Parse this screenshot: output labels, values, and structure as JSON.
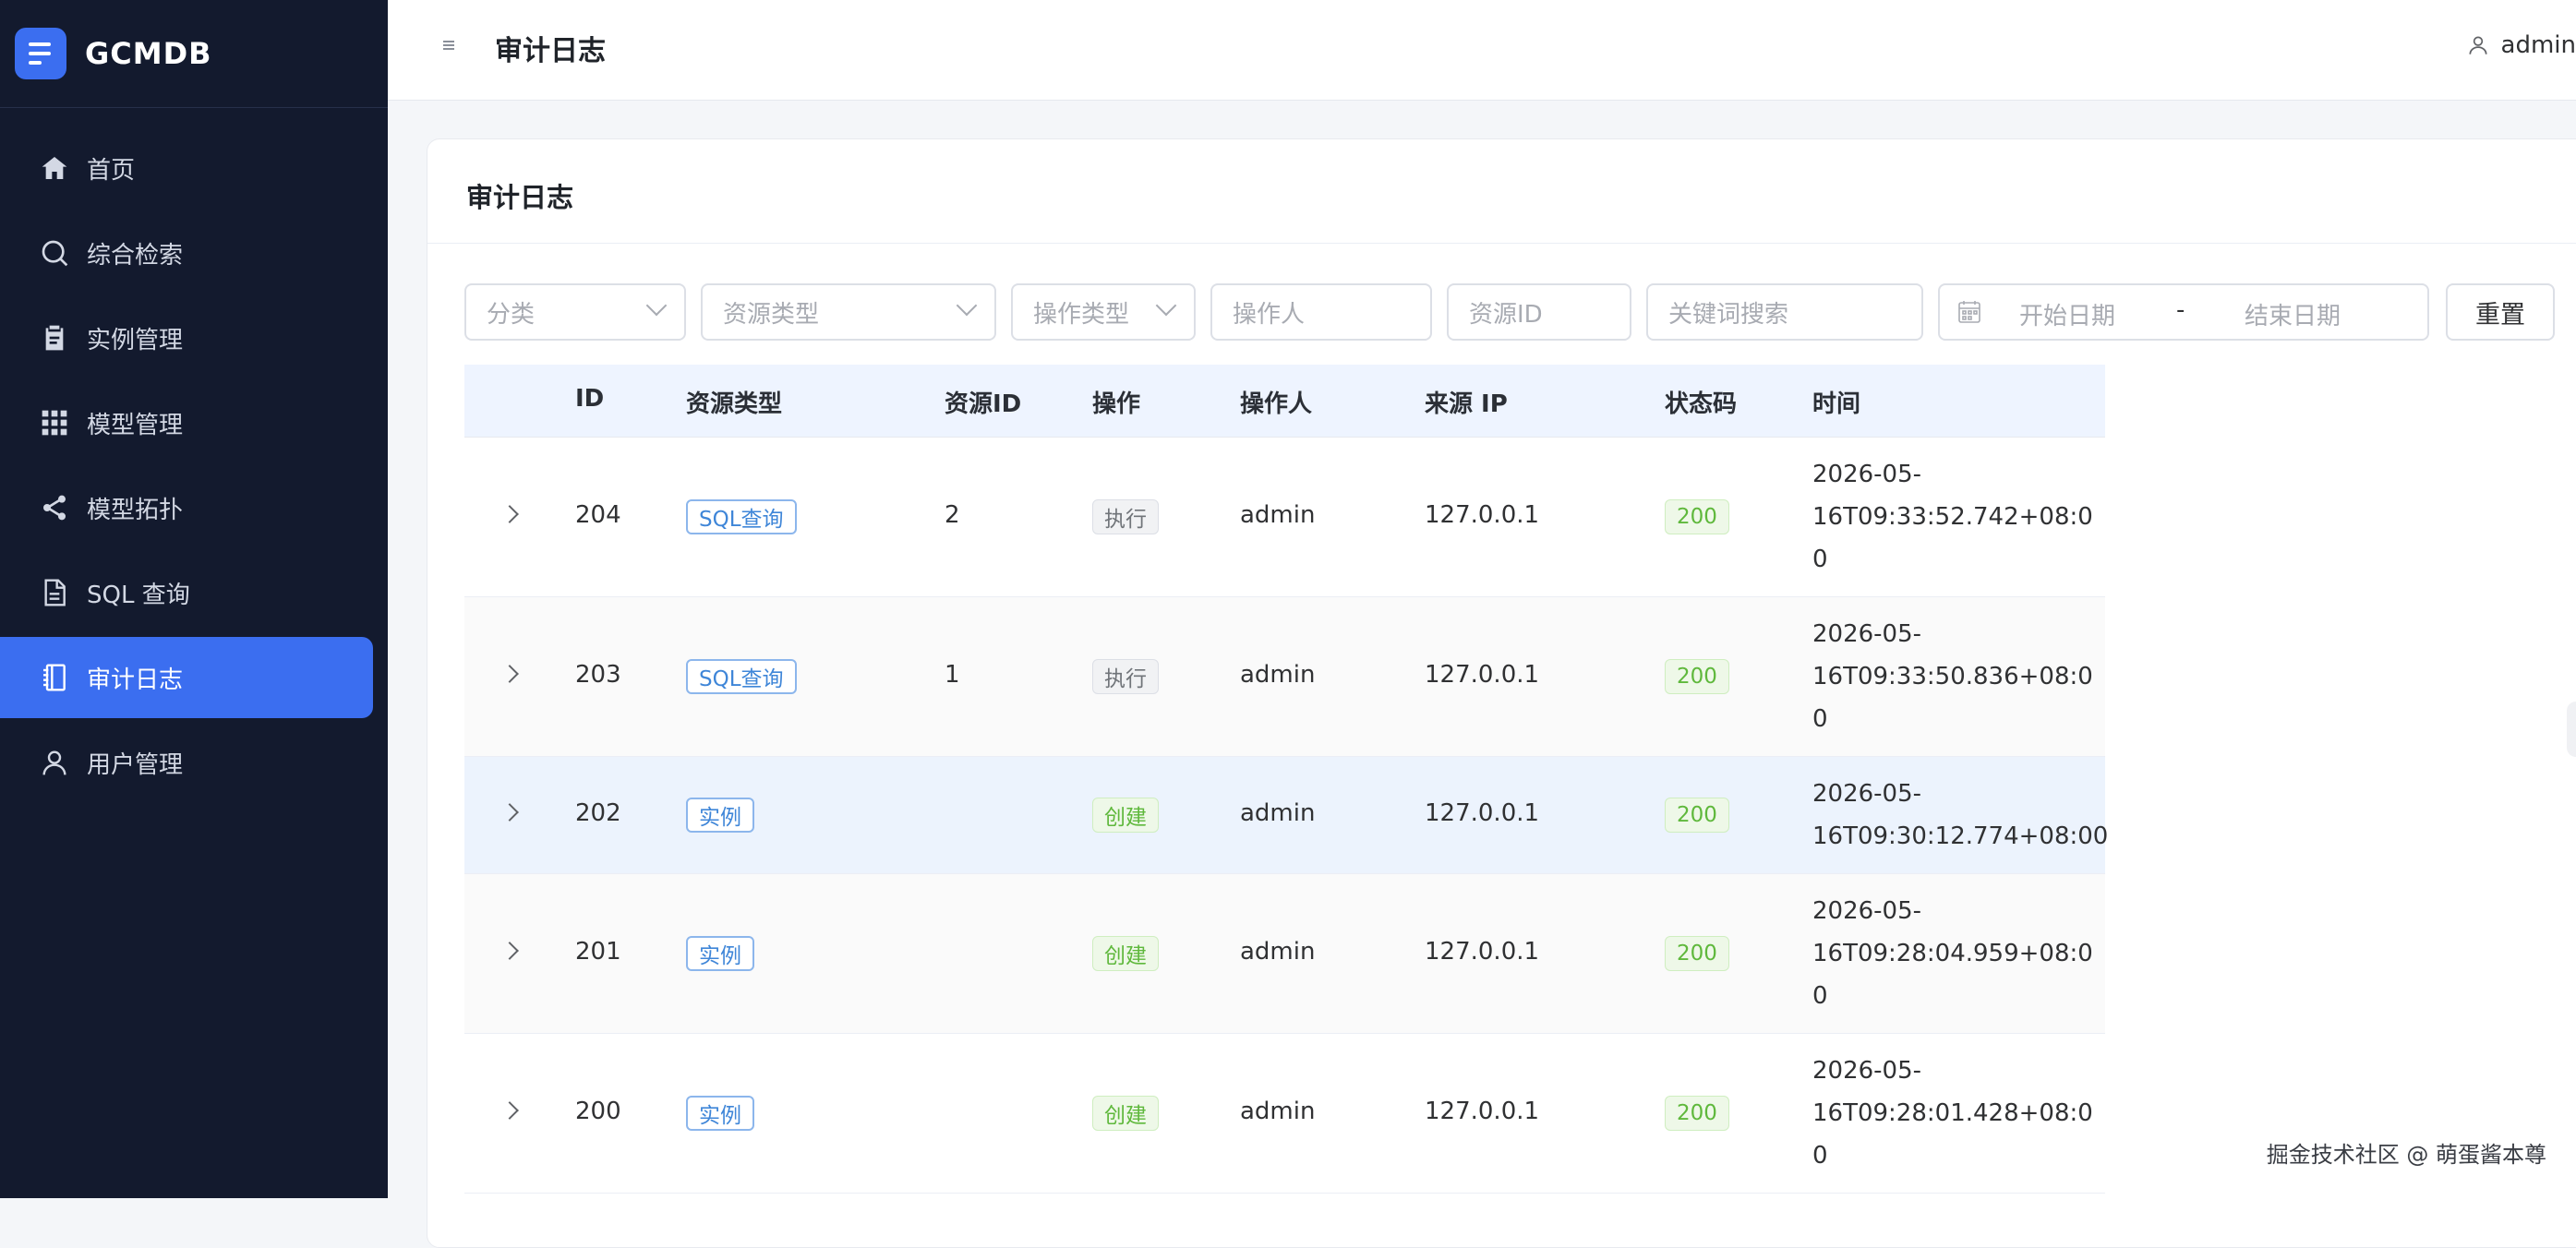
{
  "app": {
    "title": "GCMDB"
  },
  "sidebar": {
    "items": [
      {
        "label": "首页",
        "icon": "home-icon",
        "active": false
      },
      {
        "label": "综合检索",
        "icon": "search-icon",
        "active": false
      },
      {
        "label": "实例管理",
        "icon": "clipboard-icon",
        "active": false
      },
      {
        "label": "模型管理",
        "icon": "grid-icon",
        "active": false
      },
      {
        "label": "模型拓扑",
        "icon": "share-icon",
        "active": false
      },
      {
        "label": "SQL 查询",
        "icon": "document-icon",
        "active": false
      },
      {
        "label": "审计日志",
        "icon": "notebook-icon",
        "active": true
      },
      {
        "label": "用户管理",
        "icon": "user-icon",
        "active": false
      }
    ]
  },
  "header": {
    "title": "审计日志",
    "user": "admin"
  },
  "card": {
    "title": "审计日志"
  },
  "filters": {
    "category_placeholder": "分类",
    "resource_type_placeholder": "资源类型",
    "operation_type_placeholder": "操作类型",
    "operator_placeholder": "操作人",
    "resource_id_placeholder": "资源ID",
    "keyword_placeholder": "关键词搜索",
    "start_date_placeholder": "开始日期",
    "date_separator": "-",
    "end_date_placeholder": "结束日期",
    "reset_label": "重置"
  },
  "table": {
    "columns": [
      "ID",
      "资源类型",
      "资源ID",
      "操作",
      "操作人",
      "来源 IP",
      "状态码",
      "时间"
    ],
    "rows": [
      {
        "id": "204",
        "resource_type": "SQL查询",
        "resource_id": "2",
        "action": "执行",
        "operator": "admin",
        "ip": "127.0.0.1",
        "status": "200",
        "time_lines": [
          "2026-05-",
          "16T09:33:52.742+08:0",
          "0"
        ]
      },
      {
        "id": "203",
        "resource_type": "SQL查询",
        "resource_id": "1",
        "action": "执行",
        "operator": "admin",
        "ip": "127.0.0.1",
        "status": "200",
        "time_lines": [
          "2026-05-",
          "16T09:33:50.836+08:0",
          "0"
        ]
      },
      {
        "id": "202",
        "resource_type": "实例",
        "resource_id": "",
        "action": "创建",
        "operator": "admin",
        "ip": "127.0.0.1",
        "status": "200",
        "time_lines": [
          "2026-05-",
          "16T09:30:12.774+08:00"
        ]
      },
      {
        "id": "201",
        "resource_type": "实例",
        "resource_id": "",
        "action": "创建",
        "operator": "admin",
        "ip": "127.0.0.1",
        "status": "200",
        "time_lines": [
          "2026-05-",
          "16T09:28:04.959+08:0",
          "0"
        ]
      },
      {
        "id": "200",
        "resource_type": "实例",
        "resource_id": "",
        "action": "创建",
        "operator": "admin",
        "ip": "127.0.0.1",
        "status": "200",
        "time_lines": [
          "2026-05-",
          "16T09:28:01.428+08:0",
          "0"
        ]
      }
    ]
  },
  "watermark": "掘金技术社区 @ 萌蛋酱本尊",
  "colors": {
    "sidebar_bg": "#131a2e",
    "accent": "#3b6ef0",
    "tag_blue": "#3f86d8",
    "tag_green": "#5fb83c"
  }
}
